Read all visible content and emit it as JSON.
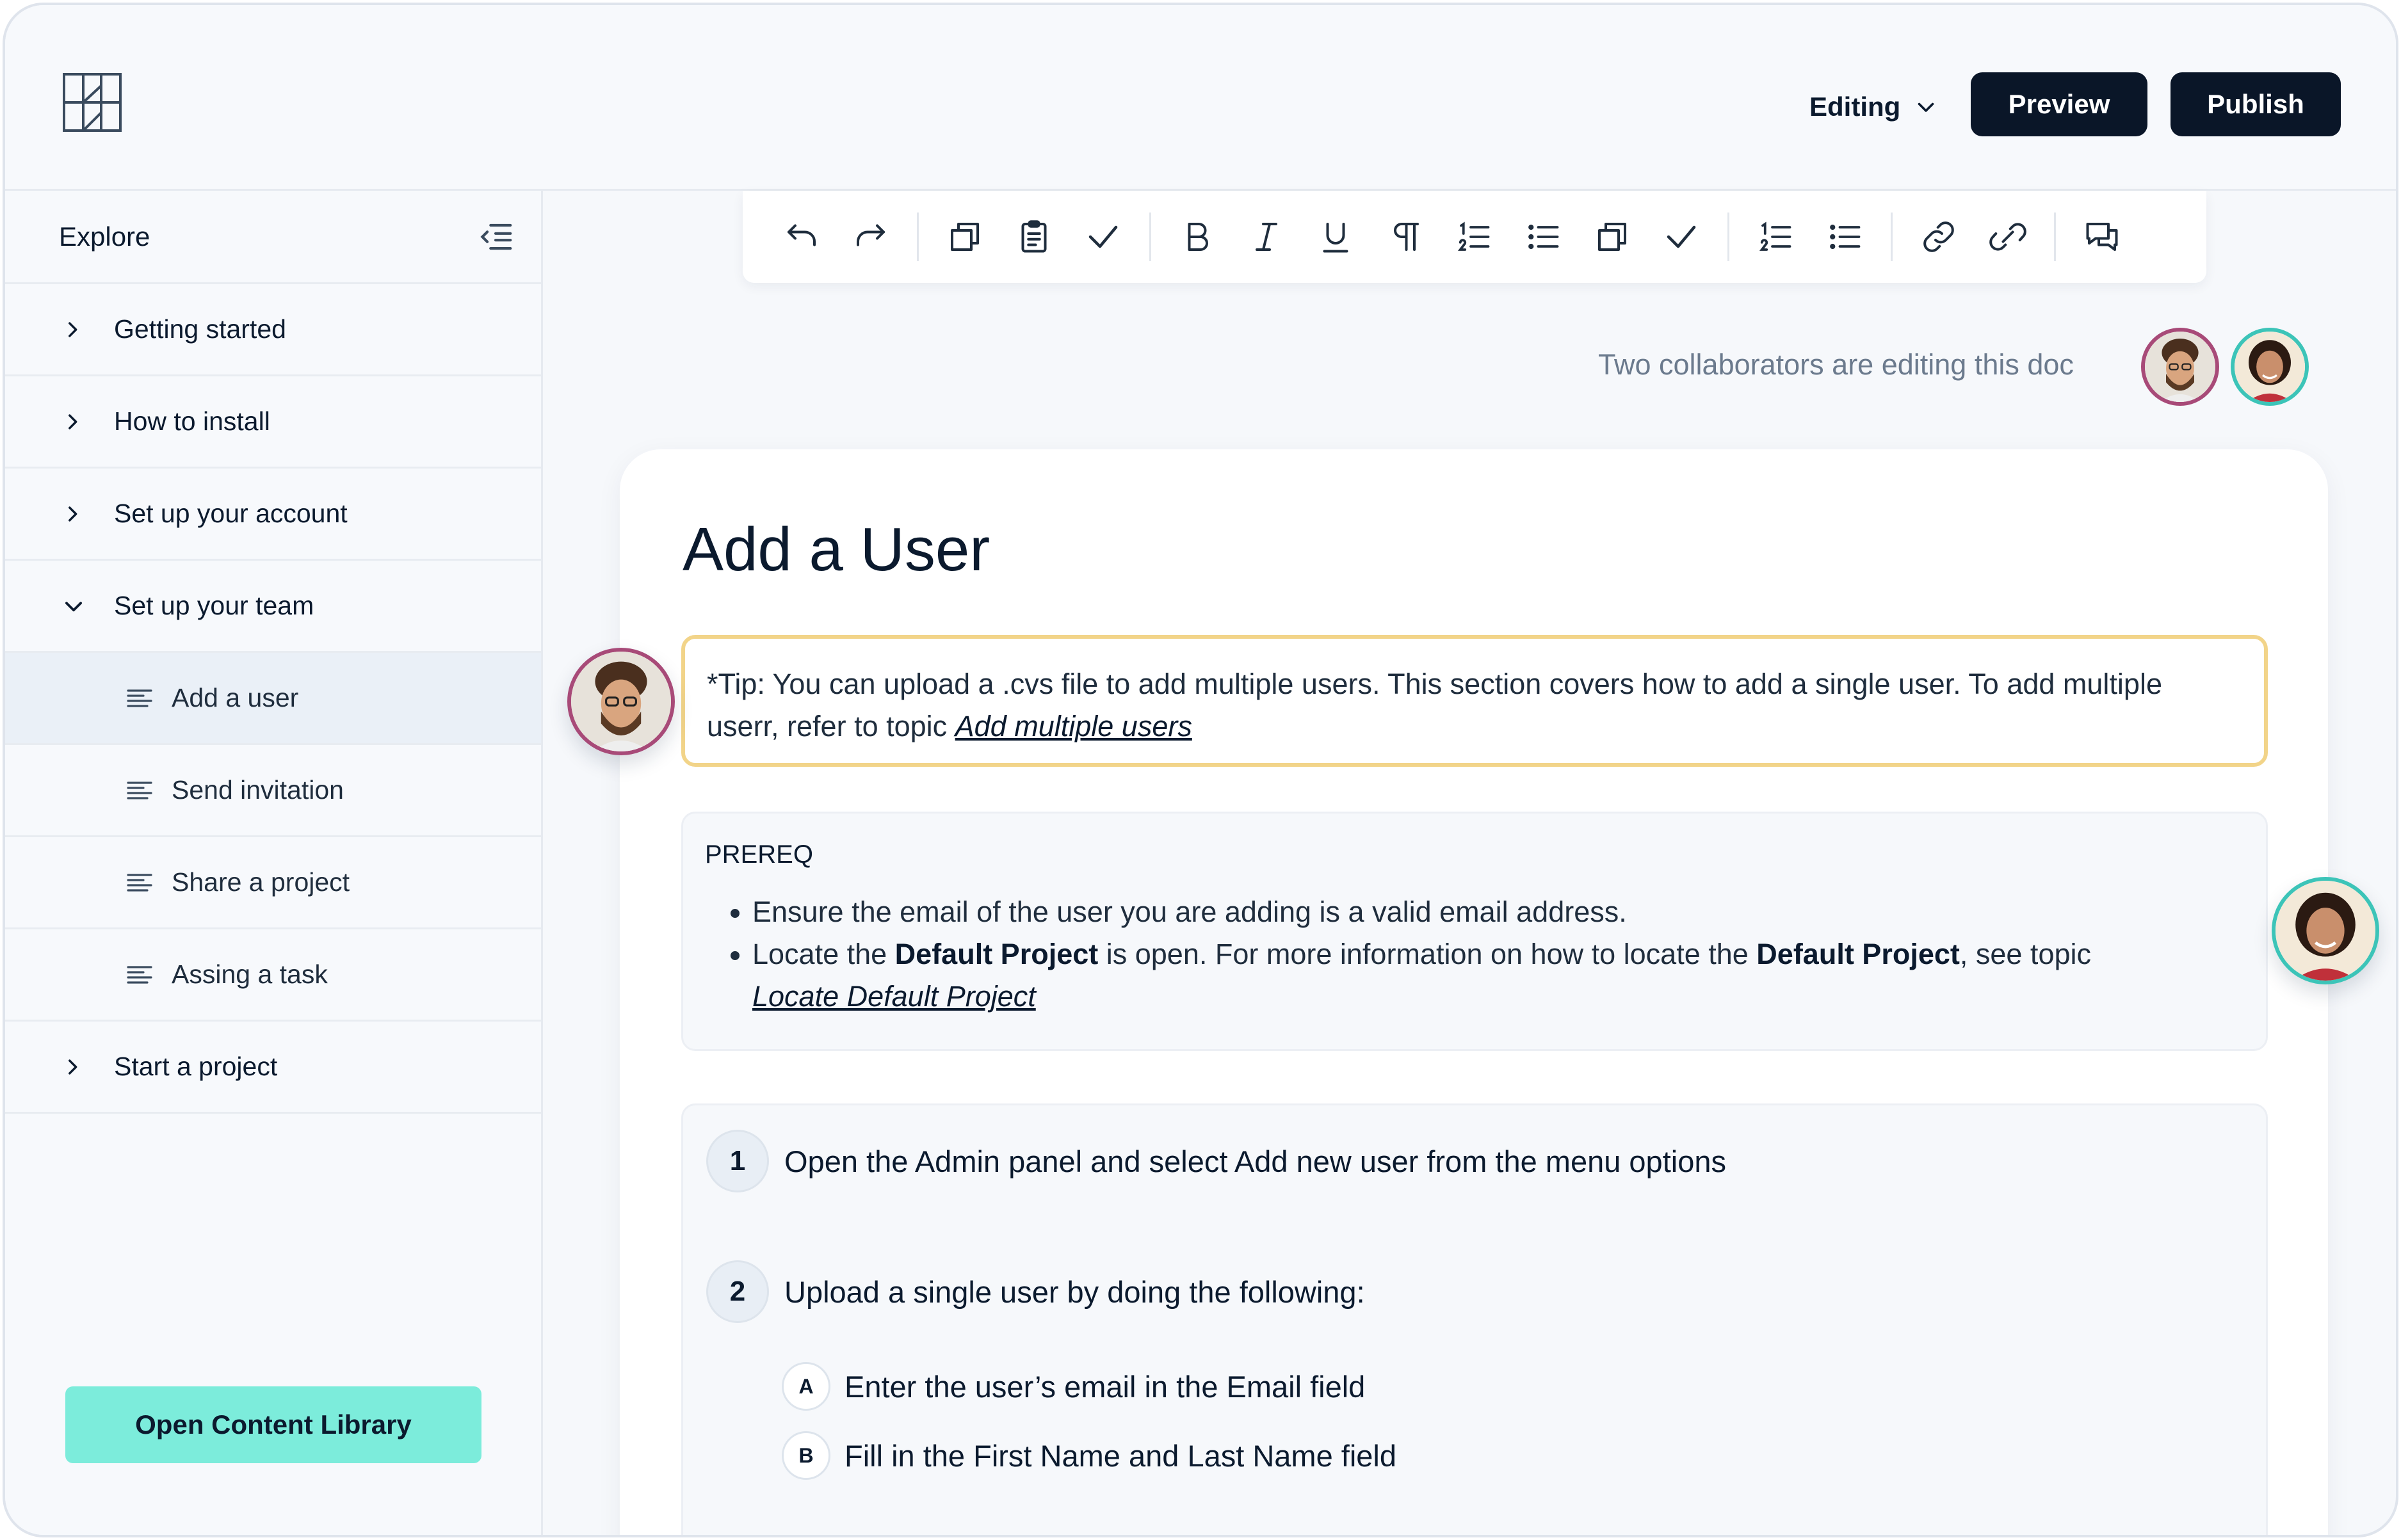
{
  "header": {
    "mode_label": "Editing",
    "preview_label": "Preview",
    "publish_label": "Publish"
  },
  "sidebar": {
    "title": "Explore",
    "items": [
      {
        "label": "Getting started",
        "expanded": false
      },
      {
        "label": "How to install",
        "expanded": false
      },
      {
        "label": "Set up your account",
        "expanded": false
      },
      {
        "label": "Set up your team",
        "expanded": true
      },
      {
        "label": "Add a user",
        "child": true,
        "active": true
      },
      {
        "label": "Send invitation",
        "child": true
      },
      {
        "label": "Share a project",
        "child": true
      },
      {
        "label": "Assing a task",
        "child": true
      },
      {
        "label": "Start a project",
        "expanded": false
      }
    ],
    "library_button": "Open Content Library"
  },
  "toolbar": {
    "icons": [
      "undo-icon",
      "redo-icon",
      "copy-icon",
      "clipboard-icon",
      "check-icon",
      "bold-icon",
      "italic-icon",
      "underline-icon",
      "paragraph-icon",
      "numbered-list-icon",
      "bullet-list-icon",
      "copy-icon",
      "check-icon",
      "numbered-list-icon",
      "bullet-list-icon",
      "link-icon",
      "unlink-icon",
      "comment-icon"
    ]
  },
  "collaborators": {
    "text": "Two collaborators are editing this doc"
  },
  "document": {
    "title": "Add a User",
    "tip": {
      "text": "*Tip: You can upload a .cvs file to add multiple users. This section covers how to add a single user. To add multiple userr, refer to topic ",
      "link": "Add multiple users"
    },
    "prereq": {
      "heading": "PREREQ",
      "item1": "Ensure the email of the user you are adding is a valid email address.",
      "item2_a": "Locate the ",
      "item2_b": "Default Project",
      "item2_c": " is open. For more information on how to locate the ",
      "item2_d": "Default Project",
      "item2_e": ", see topic",
      "item2_link": "Locate Default Project"
    },
    "steps": [
      {
        "num": "1",
        "text": "Open the Admin panel and select Add new user from the menu options"
      },
      {
        "num": "2",
        "text": "Upload a single user by doing the following:"
      }
    ],
    "substeps": [
      {
        "letter": "A",
        "text": "Enter the user’s email in the Email field"
      },
      {
        "letter": "B",
        "text": "Fill in the First Name and Last Name field"
      }
    ]
  },
  "colors": {
    "accent": "#7cecdb",
    "dark": "#0a1628",
    "tip_border": "#f2d489",
    "collab_1": "#a84a78",
    "collab_2": "#3cc4b8"
  }
}
